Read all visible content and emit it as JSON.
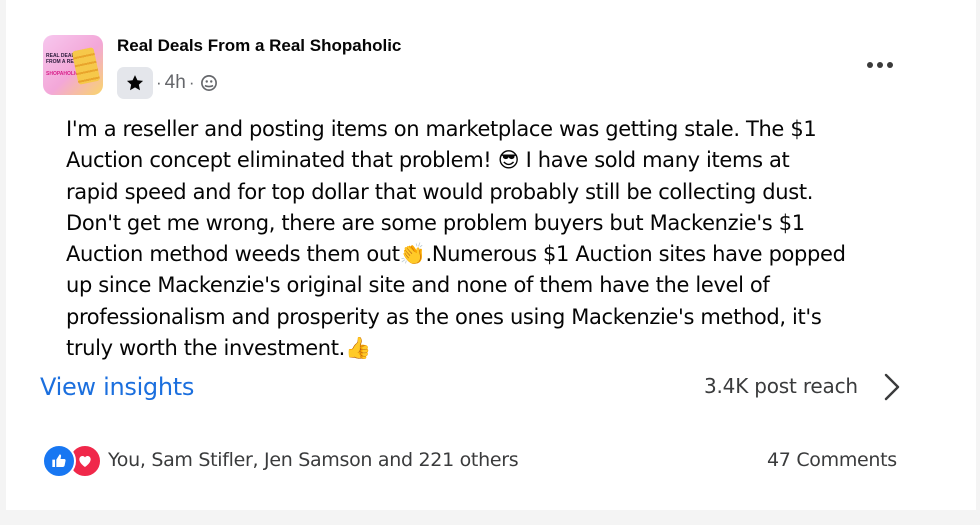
{
  "post": {
    "group_name": "Real Deals From a Real Shopaholic",
    "avatar_text": "REAL DEALS FROM A REAL",
    "avatar_brand": "SHOPAHOLIC",
    "separator": "·",
    "time": "4h",
    "body": "I'm a reseller and posting items on marketplace was getting stale. The $1\nAuction concept eliminated that problem! 😎 I have sold many items at\nrapid speed and for top dollar that would probably still be collecting dust.\nDon't get me wrong, there are some problem buyers but Mackenzie's $1\nAuction method weeds them out👏.Numerous $1 Auction sites have popped\nup since Mackenzie's original site and none of them have the level of\nprofessionalism and prosperity as the ones using Mackenzie's method, it's\ntruly worth the investment.👍",
    "view_insights": "View insights",
    "reach": "3.4K post reach",
    "reactions_text": "You, Sam Stifler, Jen Samson and 221 others",
    "comments": "47 Comments"
  },
  "icons": {
    "badge": "star-icon",
    "audience": "globe-icon",
    "menu": "more-icon",
    "reach_arrow": "chevron-right-icon",
    "reaction_1": "like-icon",
    "reaction_2": "love-icon"
  },
  "colors": {
    "link": "#1b6fde",
    "like": "#1877f2",
    "love": "#f0284a"
  }
}
